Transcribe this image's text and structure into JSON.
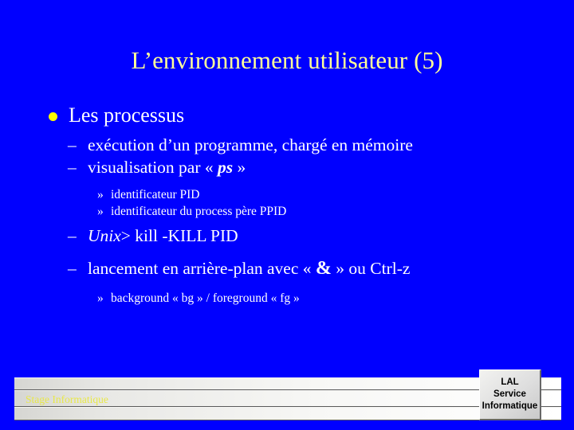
{
  "slide": {
    "background_color": "#0000FF",
    "title": "L’environnement utilisateur (5)",
    "title_color": "#FFFF99"
  },
  "content": {
    "level1": {
      "bullet_glyph": "●",
      "text": "Les processus"
    },
    "items": [
      {
        "level": 2,
        "marker": "–",
        "text": "exécution d’un programme, chargé en mémoire"
      },
      {
        "level": 2,
        "marker": "–",
        "prefix": "visualisation par « ",
        "emphasis": "ps",
        "suffix": " »"
      },
      {
        "level": 3,
        "marker": "»",
        "text": "identificateur PID"
      },
      {
        "level": 3,
        "marker": "»",
        "text": "identificateur du process père PPID"
      },
      {
        "level": 2,
        "marker": "–",
        "prompt": "Unix",
        "command": "> kill -KILL PID"
      },
      {
        "level": 2,
        "marker": "–",
        "prefix": "lancement en arrière-plan avec « ",
        "emphasis": "&",
        "suffix": " » ou Ctrl-z"
      },
      {
        "level": 3,
        "marker": "»",
        "text": "background « bg » /  foreground « fg »"
      }
    ]
  },
  "footer": {
    "label": "Stage Informatique",
    "label_color": "#E8E84A"
  },
  "logo": {
    "line1": "LAL",
    "line2": "Service",
    "line3": "Informatique"
  }
}
